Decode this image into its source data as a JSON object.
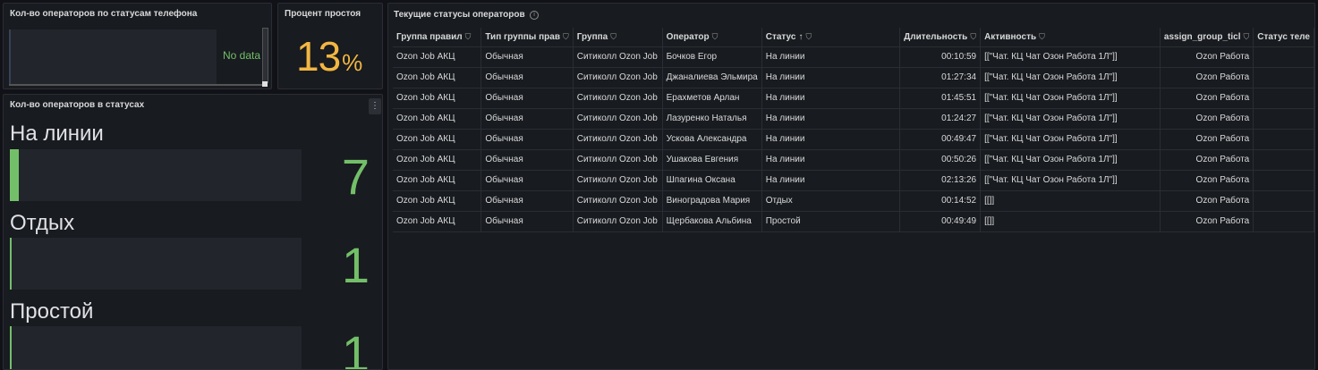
{
  "panels": {
    "phone_status_counts": {
      "title": "Кол-во операторов по статусам телефона",
      "no_data": "No data"
    },
    "idle_percent": {
      "title": "Процент простоя",
      "value": "13",
      "unit": "%"
    },
    "operators_in_status": {
      "title": "Кол-во операторов в статусах",
      "menu_icon": "⋮",
      "items": [
        {
          "label": "На линии",
          "value": "7",
          "fill_fraction": 0.03
        },
        {
          "label": "Отдых",
          "value": "1",
          "fill_fraction": 0.006
        },
        {
          "label": "Простой",
          "value": "1",
          "fill_fraction": 0.006
        }
      ]
    },
    "current_statuses": {
      "title": "Текущие статусы операторов",
      "info_icon": "i",
      "columns": [
        "Группа правил",
        "Тип группы прав",
        "Группа",
        "Оператор",
        "Статус",
        "Длительность",
        "Активность",
        "assign_group_ticl",
        "Статус теле"
      ],
      "rows": [
        [
          "Ozon Job АКЦ",
          "Обычная",
          "Ситиколл Ozon Job",
          "Бочков Егор",
          "На линии",
          "00:10:59",
          "[[\"Чат. КЦ Чат Озон Работа 1Л\"]]",
          "Ozon Работа",
          ""
        ],
        [
          "Ozon Job АКЦ",
          "Обычная",
          "Ситиколл Ozon Job",
          "Джаналиева Эльмира",
          "На линии",
          "01:27:34",
          "[[\"Чат. КЦ Чат Озон Работа 1Л\"]]",
          "Ozon Работа",
          ""
        ],
        [
          "Ozon Job АКЦ",
          "Обычная",
          "Ситиколл Ozon Job",
          "Ерахметов Арлан",
          "На линии",
          "01:45:51",
          "[[\"Чат. КЦ Чат Озон Работа 1Л\"]]",
          "Ozon Работа",
          ""
        ],
        [
          "Ozon Job АКЦ",
          "Обычная",
          "Ситиколл Ozon Job",
          "Лазуренко Наталья",
          "На линии",
          "01:24:27",
          "[[\"Чат. КЦ Чат Озон Работа 1Л\"]]",
          "Ozon Работа",
          ""
        ],
        [
          "Ozon Job АКЦ",
          "Обычная",
          "Ситиколл Ozon Job",
          "Ускова Александра",
          "На линии",
          "00:49:47",
          "[[\"Чат. КЦ Чат Озон Работа 1Л\"]]",
          "Ozon Работа",
          ""
        ],
        [
          "Ozon Job АКЦ",
          "Обычная",
          "Ситиколл Ozon Job",
          "Ушакова Евгения",
          "На линии",
          "00:50:26",
          "[[\"Чат. КЦ Чат Озон Работа 1Л\"]]",
          "Ozon Работа",
          ""
        ],
        [
          "Ozon Job АКЦ",
          "Обычная",
          "Ситиколл Ozon Job",
          "Шпагина Оксана",
          "На линии",
          "02:13:26",
          "[[\"Чат. КЦ Чат Озон Работа 1Л\"]]",
          "Ozon Работа",
          ""
        ],
        [
          "Ozon Job АКЦ",
          "Обычная",
          "Ситиколл Ozon Job",
          "Виноградова Мария",
          "Отдых",
          "00:14:52",
          "[[]]",
          "Ozon Работа",
          ""
        ],
        [
          "Ozon Job АКЦ",
          "Обычная",
          "Ситиколл Ozon Job",
          "Щербакова Альбина",
          "Простой",
          "00:49:49",
          "[[]]",
          "Ozon Работа",
          ""
        ]
      ]
    }
  },
  "colors": {
    "accent_green": "#73bf69",
    "accent_orange": "#f2b642",
    "background": "#111217",
    "panel": "#181b1f"
  }
}
